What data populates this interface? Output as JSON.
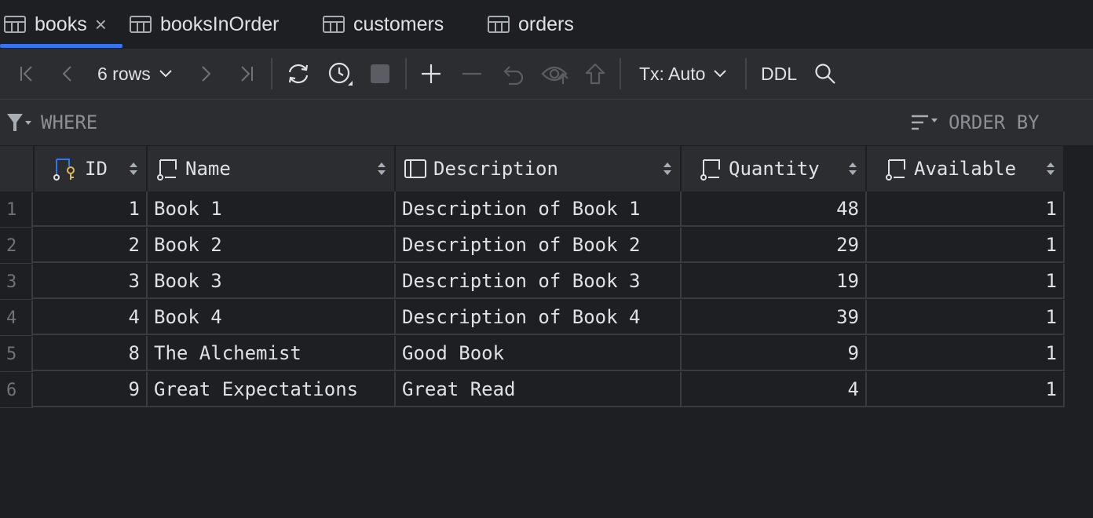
{
  "tabs": [
    {
      "label": "books",
      "icon": "table-icon",
      "active": true
    },
    {
      "label": "booksInOrder",
      "icon": "table-icon"
    },
    {
      "label": "customers",
      "icon": "table-icon"
    },
    {
      "label": "orders",
      "icon": "table-icon"
    }
  ],
  "toolbar": {
    "rows_label": "6 rows",
    "tx_label": "Tx: Auto",
    "ddl_label": "DDL"
  },
  "filter": {
    "where_label": "WHERE",
    "order_label": "ORDER BY"
  },
  "colors": {
    "accent": "#3574f0",
    "background": "#1e1f22",
    "panel": "#2b2d30",
    "key_icon": "#e2b75b"
  },
  "columns": [
    "ID",
    "Name",
    "Description",
    "Quantity",
    "Available"
  ],
  "rows": [
    {
      "num": "1",
      "id": "1",
      "name": "Book 1",
      "description": "Description of Book 1",
      "quantity": "48",
      "available": "1"
    },
    {
      "num": "2",
      "id": "2",
      "name": "Book 2",
      "description": "Description of Book 2",
      "quantity": "29",
      "available": "1"
    },
    {
      "num": "3",
      "id": "3",
      "name": "Book 3",
      "description": "Description of Book 3",
      "quantity": "19",
      "available": "1"
    },
    {
      "num": "4",
      "id": "4",
      "name": "Book 4",
      "description": "Description of Book 4",
      "quantity": "39",
      "available": "1"
    },
    {
      "num": "5",
      "id": "8",
      "name": "The Alchemist",
      "description": "Good Book",
      "quantity": "9",
      "available": "1"
    },
    {
      "num": "6",
      "id": "9",
      "name": "Great Expectations",
      "description": "Great Read",
      "quantity": "4",
      "available": "1"
    }
  ]
}
